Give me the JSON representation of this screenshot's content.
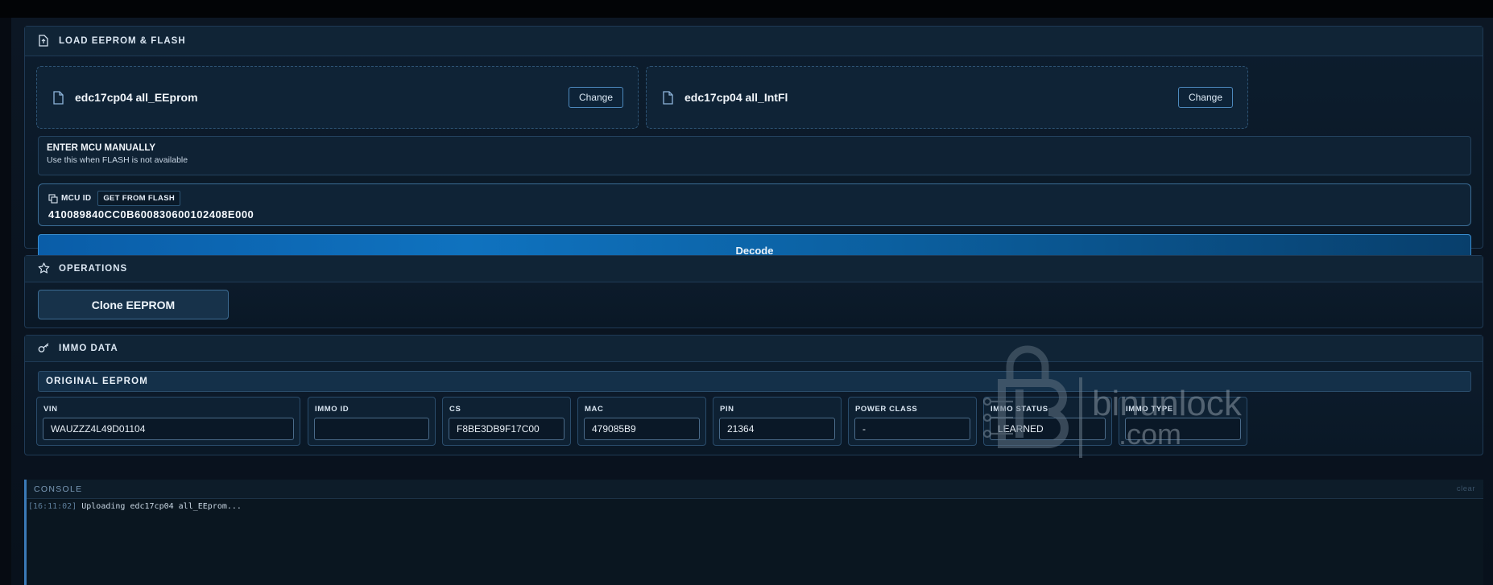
{
  "load_panel": {
    "title": "LOAD EEPROM & FLASH",
    "eeprom_file": {
      "name": "edc17cp04 all_EEprom",
      "change_label": "Change"
    },
    "flash_file": {
      "name": "edc17cp04 all_IntFl",
      "change_label": "Change"
    },
    "manual": {
      "title": "ENTER MCU MANUALLY",
      "subtitle": "Use this when FLASH is not available"
    },
    "mcu": {
      "label": "MCU ID",
      "get_from_flash": "GET FROM FLASH",
      "value": "410089840CC0B600830600102408E000"
    },
    "decode_label": "Decode"
  },
  "operations_panel": {
    "title": "OPERATIONS",
    "clone_label": "Clone EEPROM"
  },
  "immo_panel": {
    "title": "IMMO DATA",
    "section_title": "ORIGINAL EEPROM",
    "fields": [
      {
        "label": "VIN",
        "value": "WAUZZZ4L49D01104"
      },
      {
        "label": "IMMO ID",
        "value": ""
      },
      {
        "label": "CS",
        "value": "F8BE3DB9F17C00"
      },
      {
        "label": "MAC",
        "value": "479085B9"
      },
      {
        "label": "PIN",
        "value": "21364"
      },
      {
        "label": "POWER CLASS",
        "value": "-"
      },
      {
        "label": "IMMO STATUS",
        "value": "LEARNED"
      },
      {
        "label": "IMMO TYPE",
        "value": ""
      }
    ]
  },
  "console": {
    "title": "CONSOLE",
    "clear_label": "clear",
    "lines": [
      {
        "time": "[16:11:02]",
        "text": "Uploading edc17cp04 all_EEprom..."
      }
    ]
  },
  "watermark": {
    "text_line1": "binunlock",
    "text_line2": ".com"
  },
  "colors": {
    "accent": "#0f72bf",
    "border": "#1f3a55",
    "background": "#060b12"
  }
}
